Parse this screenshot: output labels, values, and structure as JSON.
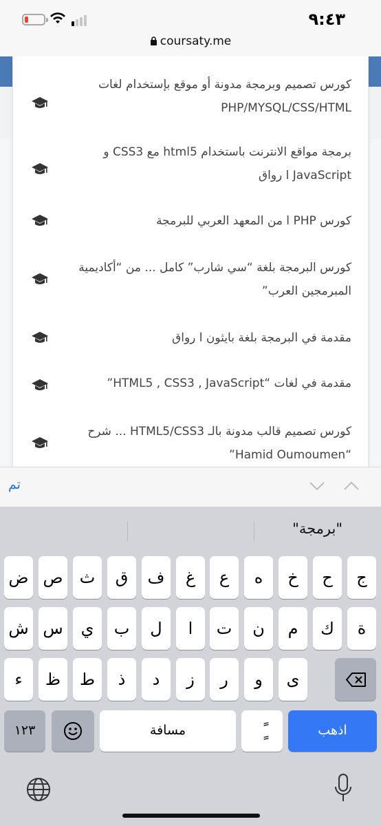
{
  "status": {
    "time": "٩:٤٣",
    "url": "coursaty.me"
  },
  "courses": [
    {
      "title": "كورس تصميم وبرمجة مدونة أو موقع بإستخدام لغات PHP/MYSQL/CSS/HTML"
    },
    {
      "title": "برمجة مواقع الانترنت باستخدام html5 مع CSS3 و JavaScript ا رواق"
    },
    {
      "title": "كورس PHP ا من المعهد العربي للبرمجة"
    },
    {
      "title": "كورس البرمجة بلغة “سي شارب” كامل ... من “أكاديمية المبرمجين العرب”"
    },
    {
      "title": "مقدمة في البرمجة بلغة بايثون ا رواق"
    },
    {
      "title": "مقدمة في لغات “HTML5 , CSS3 , JavaScript”"
    },
    {
      "title": "كورس تصميم قالب مدونة بالـ HTML5/CSS3 ... شرح “Hamid Oumoumen”"
    }
  ],
  "toolbar": {
    "done_label": "تم"
  },
  "keyboard": {
    "suggestion": "\"برمجة\"",
    "row1": [
      "ج",
      "ح",
      "خ",
      "ه",
      "ع",
      "غ",
      "ف",
      "ق",
      "ث",
      "ص",
      "ض"
    ],
    "row2": [
      "ة",
      "ك",
      "م",
      "ن",
      "ت",
      "ا",
      "ل",
      "ب",
      "ي",
      "س",
      "ش"
    ],
    "row3": [
      "ى",
      "و",
      "ر",
      "ز",
      "د",
      "ذ",
      "ط",
      "ظ",
      "ء"
    ],
    "numbers_label": "١٢٣",
    "tanween_label": "ًٍ",
    "space_label": "مسافة",
    "go_label": "اذهب"
  },
  "icons": {
    "course": "graduation-cap-icon",
    "wifi": "wifi-icon",
    "battery": "battery-icon",
    "lock": "lock-icon",
    "globe": "globe-icon",
    "mic": "microphone-icon",
    "backspace": "backspace-icon",
    "emoji": "emoji-icon"
  },
  "colors": {
    "accent": "#3478f6",
    "header_blue": "#4a7bb7",
    "battery_low": "#ff3b30"
  }
}
